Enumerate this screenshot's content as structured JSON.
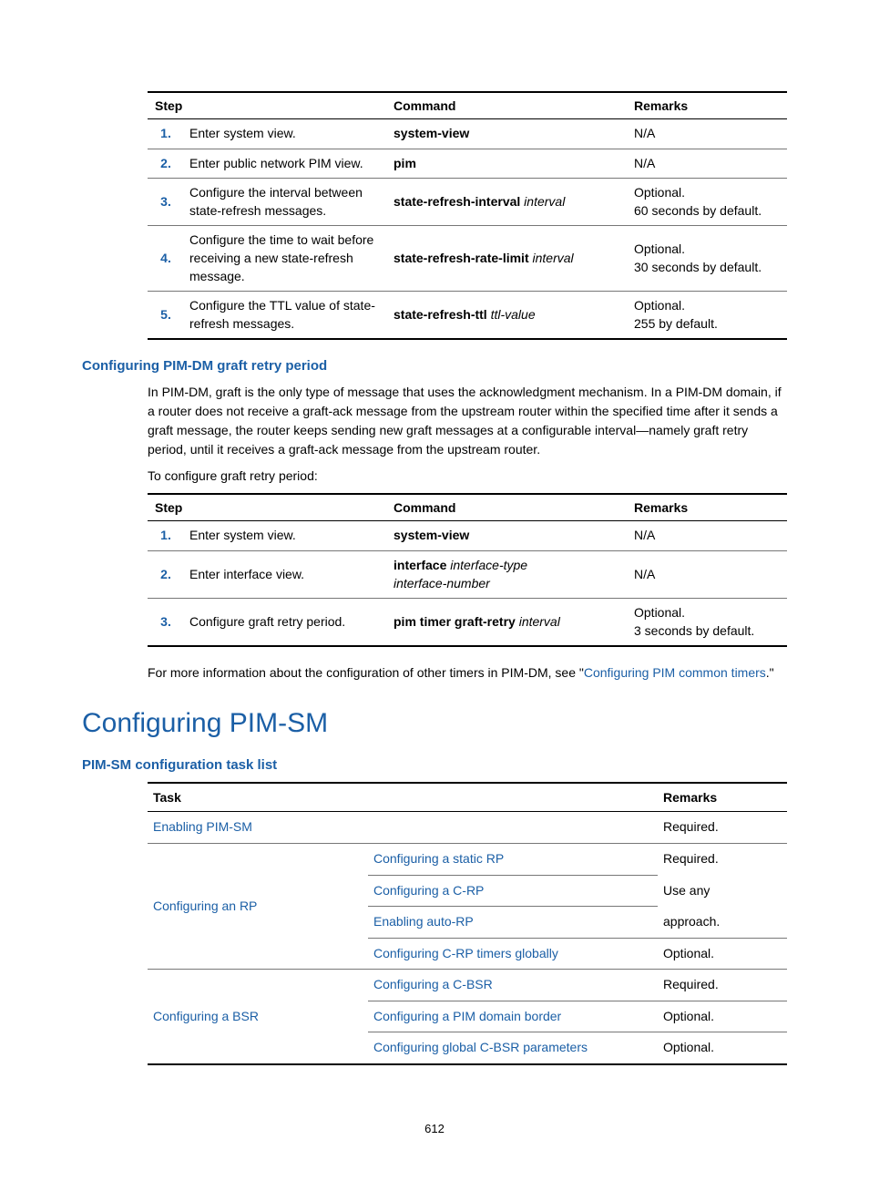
{
  "table1": {
    "headers": {
      "step": "Step",
      "command": "Command",
      "remarks": "Remarks"
    },
    "rows": [
      {
        "num": "1.",
        "step": "Enter system view.",
        "cmd_bold": "system-view",
        "cmd_italic": "",
        "remarks": [
          "N/A"
        ]
      },
      {
        "num": "2.",
        "step": "Enter public network PIM view.",
        "cmd_bold": "pim",
        "cmd_italic": "",
        "remarks": [
          "N/A"
        ]
      },
      {
        "num": "3.",
        "step": "Configure the interval between state-refresh messages.",
        "cmd_bold": "state-refresh-interval",
        "cmd_italic": " interval",
        "remarks": [
          "Optional.",
          "60 seconds by default."
        ]
      },
      {
        "num": "4.",
        "step": "Configure the time to wait before receiving a new state-refresh message.",
        "cmd_bold": "state-refresh-rate-limit",
        "cmd_italic": " interval",
        "remarks": [
          "Optional.",
          "30 seconds by default."
        ]
      },
      {
        "num": "5.",
        "step": "Configure the TTL value of state-refresh messages.",
        "cmd_bold": "state-refresh-ttl",
        "cmd_italic": " ttl-value",
        "remarks": [
          "Optional.",
          "255 by default."
        ]
      }
    ]
  },
  "section1": {
    "heading": "Configuring PIM-DM graft retry period",
    "para1": "In PIM-DM, graft is the only type of message that uses the acknowledgment mechanism. In a PIM-DM domain, if a router does not receive a graft-ack message from the upstream router within the specified time after it sends a graft message, the router keeps sending new graft messages at a configurable interval—namely graft retry period, until it receives a graft-ack message from the upstream router.",
    "para2": "To configure graft retry period:"
  },
  "table2": {
    "headers": {
      "step": "Step",
      "command": "Command",
      "remarks": "Remarks"
    },
    "rows": [
      {
        "num": "1.",
        "step": "Enter system view.",
        "cmd_bold": "system-view",
        "cmd_italic": "",
        "remarks": [
          "N/A"
        ]
      },
      {
        "num": "2.",
        "step": "Enter interface view.",
        "cmd_bold": "interface",
        "cmd_italic_multiline": [
          " interface-type",
          "interface-number"
        ],
        "remarks": [
          "N/A"
        ]
      },
      {
        "num": "3.",
        "step": "Configure graft retry period.",
        "cmd_bold": "pim timer graft-retry",
        "cmd_italic": " interval",
        "remarks": [
          "Optional.",
          "3 seconds by default."
        ]
      }
    ]
  },
  "para_after_table2": {
    "pre": "For more information about the configuration of other timers in PIM-DM, see \"",
    "link": "Configuring PIM common timers",
    "post": ".\""
  },
  "main_heading": "Configuring PIM-SM",
  "subheading": "PIM-SM configuration task list",
  "table3": {
    "headers": {
      "task": "Task",
      "remarks": "Remarks"
    },
    "rows": {
      "r1": {
        "task": "Enabling PIM-SM",
        "remarks": "Required."
      },
      "r2group": {
        "left": "Configuring an RP",
        "subs": [
          {
            "sub": "Configuring a static RP",
            "remark": "Required."
          },
          {
            "sub": "Configuring a C-RP",
            "remark": "Use any"
          },
          {
            "sub": "Enabling auto-RP",
            "remark": "approach."
          },
          {
            "sub": "Configuring C-RP timers globally",
            "remark": "Optional."
          }
        ]
      },
      "r3group": {
        "left": "Configuring a BSR",
        "subs": [
          {
            "sub": "Configuring a C-BSR",
            "remark": "Required."
          },
          {
            "sub": "Configuring a PIM domain border",
            "remark": "Optional."
          },
          {
            "sub": "Configuring global C-BSR parameters",
            "remark": "Optional."
          }
        ]
      }
    }
  },
  "page_number": "612"
}
